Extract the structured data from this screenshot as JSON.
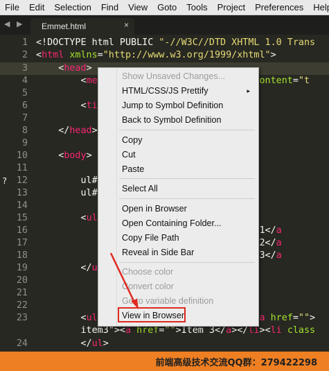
{
  "menubar": {
    "items": [
      "File",
      "Edit",
      "Selection",
      "Find",
      "View",
      "Goto",
      "Tools",
      "Project",
      "Preferences",
      "Help"
    ]
  },
  "tabbar": {
    "nav_arrows": "◀ ▶",
    "active_tab": "Emmet.html",
    "close_glyph": "×"
  },
  "editor": {
    "active_line": "3",
    "fold_marker": "?",
    "lines": {
      "l1": "1",
      "l2": "2",
      "l3": "3",
      "l4": "4",
      "l5": "5",
      "l6": "6",
      "l7": "7",
      "l8": "8",
      "l9": "9",
      "l10": "10",
      "l11": "11",
      "l12": "12",
      "l13": "13",
      "l14": "14",
      "l15": "15",
      "l16": "16",
      "l17": "17",
      "l18": "18",
      "l19": "19",
      "l20": "20",
      "l21": "21",
      "l22": "22",
      "l23": "23",
      "l24": "24"
    }
  },
  "context_menu": {
    "items": [
      {
        "label": "Show Unsaved Changes...",
        "disabled": true
      },
      {
        "label": "HTML/CSS/JS Prettify",
        "submenu": true
      },
      {
        "label": "Jump to Symbol Definition"
      },
      {
        "label": "Back to Symbol Definition"
      },
      {
        "label": "Copy"
      },
      {
        "label": "Cut"
      },
      {
        "label": "Paste"
      },
      {
        "label": "Select All"
      },
      {
        "label": "Open in Browser"
      },
      {
        "label": "Open Containing Folder..."
      },
      {
        "label": "Copy File Path"
      },
      {
        "label": "Reveal in Side Bar"
      },
      {
        "label": "Choose color",
        "disabled": true
      },
      {
        "label": "Convert color",
        "disabled": true
      },
      {
        "label": "Go to variable definition",
        "disabled": true
      },
      {
        "label": "View in Browser",
        "highlighted": true
      }
    ],
    "submenu_arrow": "▸"
  },
  "footer": {
    "text": "前端高级技术交流QQ群：279422298",
    "background": "#ee7f22"
  },
  "colors": {
    "editor_bg": "#272822",
    "tag": "#f92672",
    "attribute": "#a6e22e",
    "string": "#e6db74",
    "annotation": "#e0281e"
  }
}
